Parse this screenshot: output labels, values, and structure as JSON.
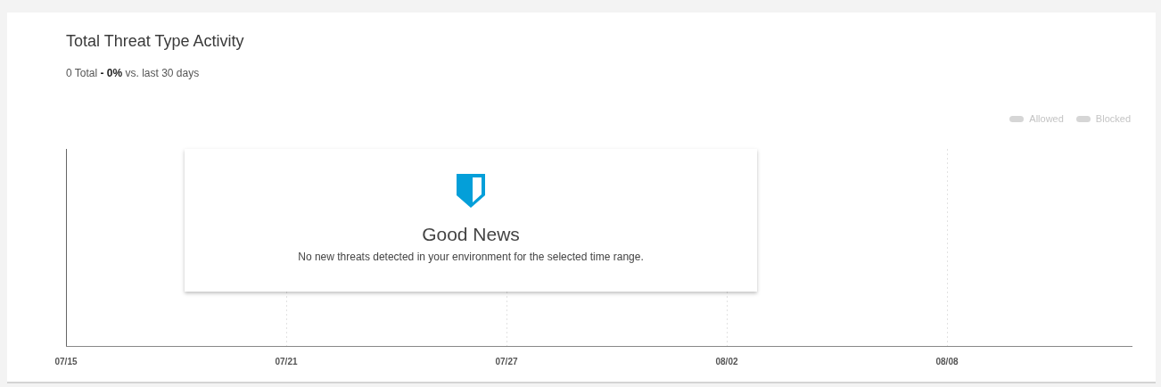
{
  "card": {
    "title": "Total Threat Type Activity",
    "summary": "0 Total **- 0%** vs. last 30 days"
  },
  "legend": [
    {
      "label": "Allowed",
      "color": "#d6d6d6"
    },
    {
      "label": "Blocked",
      "color": "#d6d6d6"
    }
  ],
  "x_labels": [
    "07/15",
    "07/21",
    "07/27",
    "08/02",
    "08/08"
  ],
  "notice": {
    "title": "Good News",
    "message": "No new threats detected in your environment for the selected time range."
  }
}
